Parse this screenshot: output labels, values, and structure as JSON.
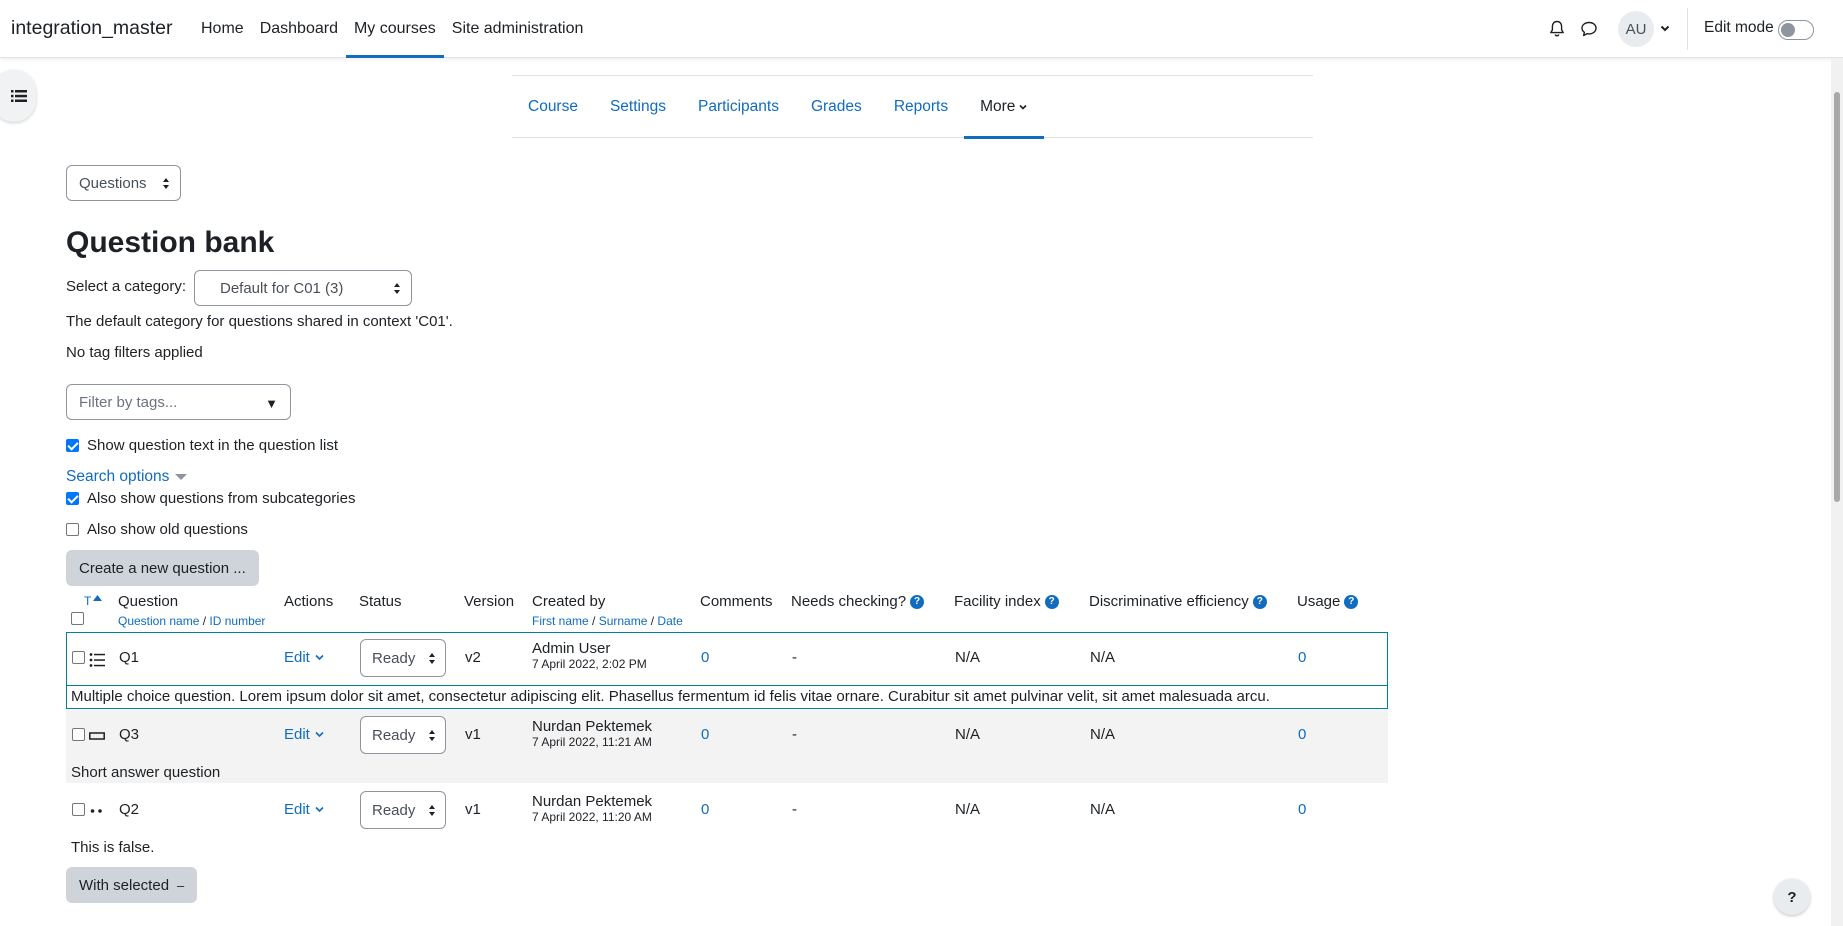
{
  "site": {
    "brand": "integration_master"
  },
  "primary_nav": [
    "Home",
    "Dashboard",
    "My courses",
    "Site administration"
  ],
  "user": {
    "initials": "AU"
  },
  "edit_mode": {
    "label": "Edit mode",
    "enabled": false
  },
  "secondary_nav": [
    "Course",
    "Settings",
    "Participants",
    "Grades",
    "Reports",
    "More"
  ],
  "page_select": {
    "value": "Questions"
  },
  "page": {
    "title": "Question bank",
    "category_label": "Select a category:",
    "category_value": "Default for C01 (3)",
    "category_description": "The default category for questions shared in context 'C01'.",
    "no_tags": "No tag filters applied",
    "tag_placeholder": "Filter by tags...",
    "show_text_label": "Show question text in the question list",
    "search_options": "Search options",
    "subcategories_label": "Also show questions from subcategories",
    "old_questions_label": "Also show old questions",
    "create_button": "Create a new question ...",
    "with_selected": "With selected"
  },
  "table": {
    "sort_t": "T",
    "headers": {
      "question": "Question",
      "question_name": "Question name",
      "id_number": "ID number",
      "actions": "Actions",
      "status": "Status",
      "version": "Version",
      "created_by": "Created by",
      "first_name": "First name",
      "surname": "Surname",
      "date": "Date",
      "comments": "Comments",
      "needs_checking": "Needs checking?",
      "facility_index": "Facility index",
      "discriminative_efficiency": "Discriminative efficiency",
      "usage": "Usage"
    },
    "rows": [
      {
        "name": "Q1",
        "icon": "multichoice-icon",
        "action": "Edit",
        "status": "Ready",
        "version": "v2",
        "creator": "Admin User",
        "date": "7 April 2022, 2:02 PM",
        "comments": "0",
        "needs_checking": "-",
        "facility": "N/A",
        "discriminative": "N/A",
        "usage": "0",
        "text": "Multiple choice question. Lorem ipsum dolor sit amet, consectetur adipiscing elit. Phasellus fermentum id felis vitae ornare. Curabitur sit amet pulvinar velit, sit amet malesuada arcu."
      },
      {
        "name": "Q3",
        "icon": "shortanswer-icon",
        "action": "Edit",
        "status": "Ready",
        "version": "v1",
        "creator": "Nurdan Pektemek",
        "date": "7 April 2022, 11:21 AM",
        "comments": "0",
        "needs_checking": "-",
        "facility": "N/A",
        "discriminative": "N/A",
        "usage": "0",
        "text": "Short answer question"
      },
      {
        "name": "Q2",
        "icon": "truefalse-icon",
        "action": "Edit",
        "status": "Ready",
        "version": "v1",
        "creator": "Nurdan Pektemek",
        "date": "7 April 2022, 11:20 AM",
        "comments": "0",
        "needs_checking": "-",
        "facility": "N/A",
        "discriminative": "N/A",
        "usage": "0",
        "text": "This is false."
      }
    ]
  },
  "colors": {
    "link": "#0f6cbf",
    "selected_row_border": "#008196",
    "row_stripe": "#f3f3f3"
  }
}
